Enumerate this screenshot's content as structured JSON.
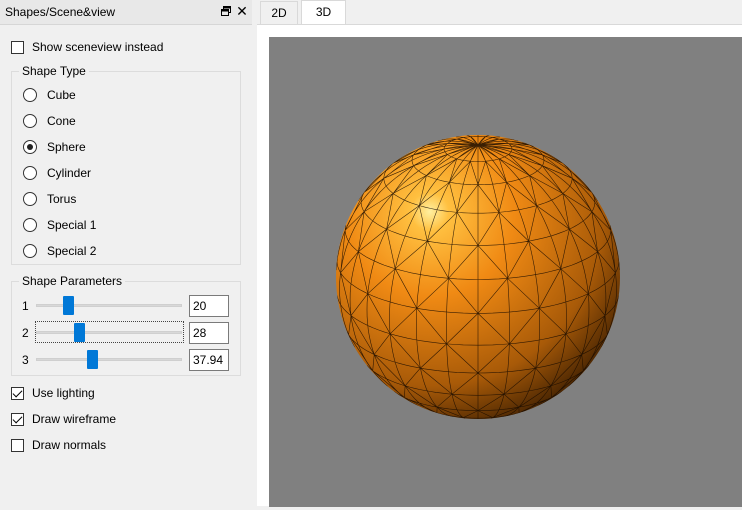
{
  "dock": {
    "title": "Shapes/Scene&view",
    "float_icon": "float-window-icon",
    "close_glyph": "✕"
  },
  "show_sceneview": {
    "label": "Show sceneview instead",
    "checked": false
  },
  "shape_type": {
    "title": "Shape Type",
    "options": [
      {
        "label": "Cube",
        "selected": false
      },
      {
        "label": "Cone",
        "selected": false
      },
      {
        "label": "Sphere",
        "selected": true
      },
      {
        "label": "Cylinder",
        "selected": false
      },
      {
        "label": "Torus",
        "selected": false
      },
      {
        "label": "Special 1",
        "selected": false
      },
      {
        "label": "Special 2",
        "selected": false
      }
    ]
  },
  "shape_parameters": {
    "title": "Shape Parameters",
    "params": [
      {
        "label": "1",
        "value": "20",
        "slider_fraction": 0.2
      },
      {
        "label": "2",
        "value": "28",
        "slider_fraction": 0.28
      },
      {
        "label": "3",
        "value": "37.94",
        "slider_fraction": 0.38
      }
    ]
  },
  "options": [
    {
      "label": "Use lighting",
      "checked": true
    },
    {
      "label": "Draw wireframe",
      "checked": true
    },
    {
      "label": "Draw normals",
      "checked": false
    }
  ],
  "tabs": [
    {
      "label": "2D",
      "active": false
    },
    {
      "label": "3D",
      "active": true
    }
  ],
  "viewport": {
    "background": "#808080",
    "shape_color": "#f08a14",
    "shape": "sphere"
  }
}
